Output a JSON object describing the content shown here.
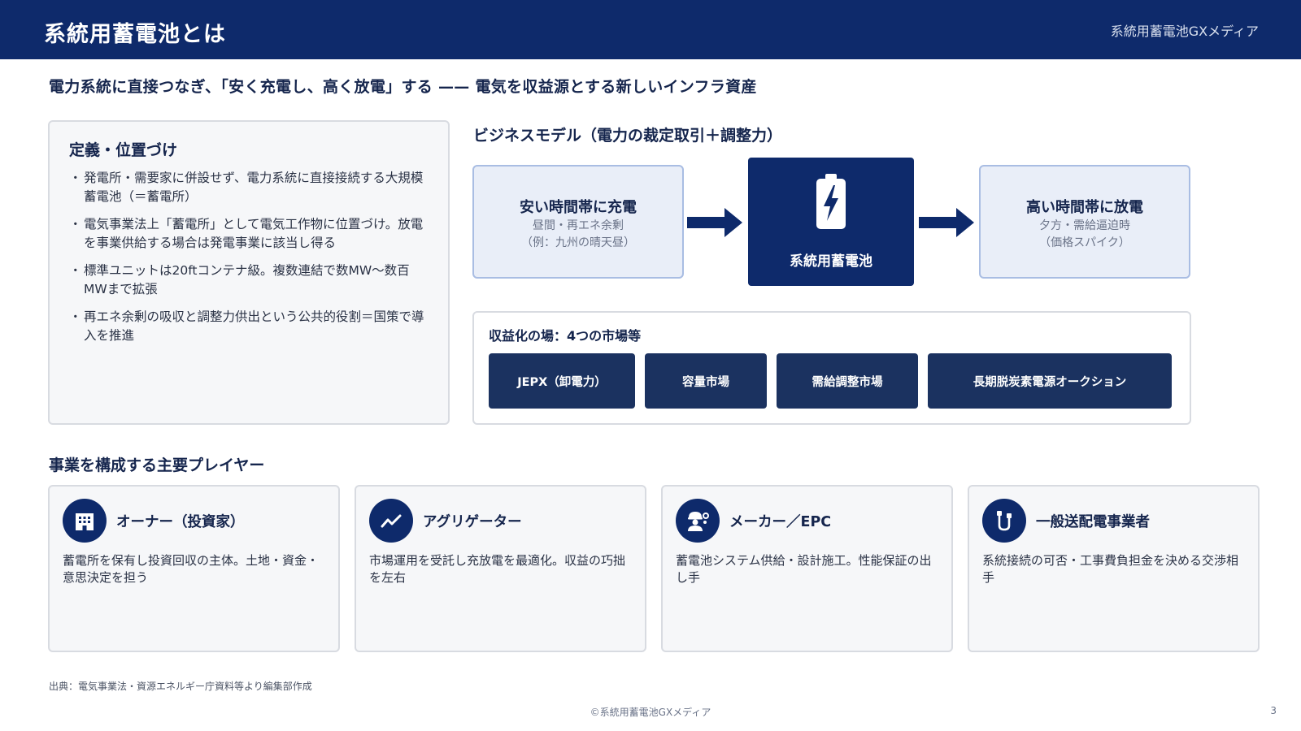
{
  "header": {
    "title": "系統用蓄電池とは",
    "brand": "系統用蓄電池GXメディア",
    "bg_color": "#0e2a6b"
  },
  "lead": "電力系統に直接つなぎ、「安く充電し、高く放電」する —— 電気を収益源とする新しいインフラ資産",
  "definition": {
    "title": "定義・位置づけ",
    "bullet": "・",
    "items": [
      "発電所・需要家に併設せず、電力系統に直接接続する大規模蓄電池（＝蓄電所）",
      "電気事業法上「蓄電所」として電気工作物に位置づけ。放電を事業供給する場合は発電事業に該当し得る",
      "標準ユニットは20ftコンテナ級。複数連結で数MW〜数百MWまで拡張",
      "再エネ余剰の吸収と調整力供出という公共的役割＝国策で導入を推進"
    ]
  },
  "business_model": {
    "title": "ビジネスモデル（電力の裁定取引＋調整力）",
    "charge": {
      "title": "安い時間帯に充電",
      "line1": "昼間・再エネ余剰",
      "line2": "（例：九州の晴天昼）"
    },
    "center": {
      "label": "系統用蓄電池",
      "icon": "battery-bolt-icon"
    },
    "discharge": {
      "title": "高い時間帯に放電",
      "line1": "夕方・需給逼迫時",
      "line2": "（価格スパイク）"
    }
  },
  "markets": {
    "title": "収益化の場：4つの市場等",
    "items": [
      "JEPX（卸電力）",
      "容量市場",
      "需給調整市場",
      "長期脱炭素電源オークション"
    ]
  },
  "players": {
    "title": "事業を構成する主要プレイヤー",
    "items": [
      {
        "name": "オーナー（投資家）",
        "desc": "蓄電所を保有し投資回収の主体。土地・資金・意思決定を担う",
        "icon": "building-icon"
      },
      {
        "name": "アグリゲーター",
        "desc": "市場運用を受託し充放電を最適化。収益の巧拙を左右",
        "icon": "trend-line-icon"
      },
      {
        "name": "メーカー／EPC",
        "desc": "蓄電池システム供給・設計施工。性能保証の出し手",
        "icon": "engineer-icon"
      },
      {
        "name": "一般送配電事業者",
        "desc": "系統接続の可否・工事費負担金を決める交渉相手",
        "icon": "grid-cable-icon"
      }
    ]
  },
  "source": "出典：電気事業法・資源エネルギー庁資料等より編集部作成",
  "footer": {
    "copyright": "©系統用蓄電池GXメディア",
    "page": "3"
  }
}
